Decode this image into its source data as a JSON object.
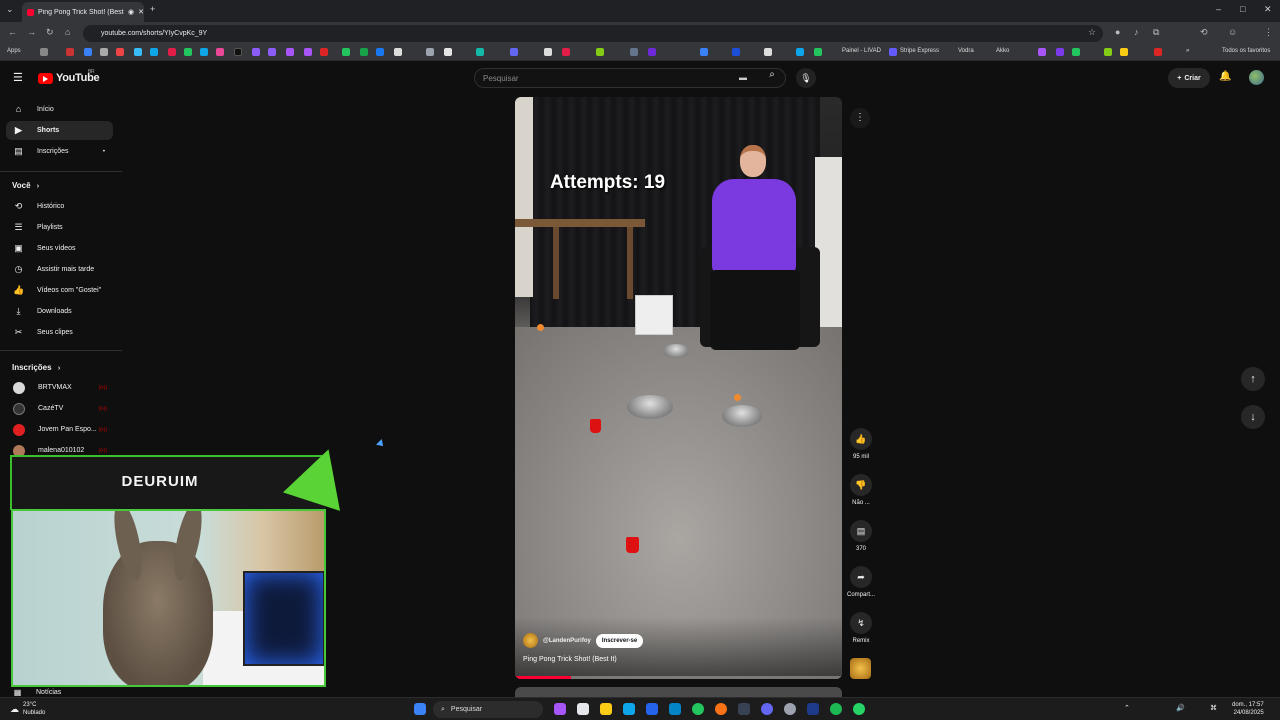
{
  "browser": {
    "tab_title": "Ping Pong Trick Shot! (Best",
    "url": "youtube.com/shorts/YIyCvpKc_9Y",
    "bookmarks": {
      "apps_label": "Apps",
      "painel": "Painel - LIVAD",
      "stripe": "Stripe Express",
      "vodra": "Vodra",
      "akko": "Akko",
      "favorites": "Todos os favoritos"
    }
  },
  "header": {
    "logo": "YouTube",
    "country": "BR",
    "search_placeholder": "Pesquisar",
    "create_label": "Criar"
  },
  "sidebar": {
    "main": [
      {
        "label": "Início",
        "icon": "home-icon"
      },
      {
        "label": "Shorts",
        "icon": "shorts-icon"
      },
      {
        "label": "Inscrições",
        "icon": "subscriptions-icon"
      }
    ],
    "voce_heading": "Você",
    "voce": [
      {
        "label": "Histórico",
        "icon": "history-icon"
      },
      {
        "label": "Playlists",
        "icon": "playlists-icon"
      },
      {
        "label": "Seus vídeos",
        "icon": "your-videos-icon"
      },
      {
        "label": "Assistir mais tarde",
        "icon": "watch-later-icon"
      },
      {
        "label": "Vídeos com \"Gostei\"",
        "icon": "liked-icon"
      },
      {
        "label": "Downloads",
        "icon": "download-icon"
      },
      {
        "label": "Seus clipes",
        "icon": "clips-icon"
      }
    ],
    "subs_heading": "Inscrições",
    "subs": [
      {
        "label": "BRTVMAX",
        "color": "#d9d9d9"
      },
      {
        "label": "CazéTV",
        "color": "#333333"
      },
      {
        "label": "Jovem Pan Espo...",
        "color": "#e02020"
      },
      {
        "label": "malena010102",
        "color": "#b07a5a"
      }
    ],
    "noticias": "Notícias"
  },
  "short": {
    "overlay_text": "Attempts: 19",
    "channel": "@LandenPurifoy",
    "subscribe_label": "Inscrever-se",
    "title": "Ping Pong Trick Shot! (Best It)",
    "progress": 0.17
  },
  "actions": {
    "likes": "95 mil",
    "dislike": "Não ...",
    "comments": "370",
    "share": "Compart...",
    "remix": "Remix"
  },
  "overlay": {
    "streamer_name": "DEURUIM"
  },
  "taskbar": {
    "weather_temp": "23°C",
    "weather_desc": "Nublado",
    "search_label": "Pesquisar",
    "time": "17:57",
    "date_line1": "dom., 17:57",
    "date_line2": "24/08/2025"
  },
  "colors": {
    "accent": "#ff0033",
    "overlay_green": "#46c83a",
    "hoodie": "#7a3ae0"
  }
}
